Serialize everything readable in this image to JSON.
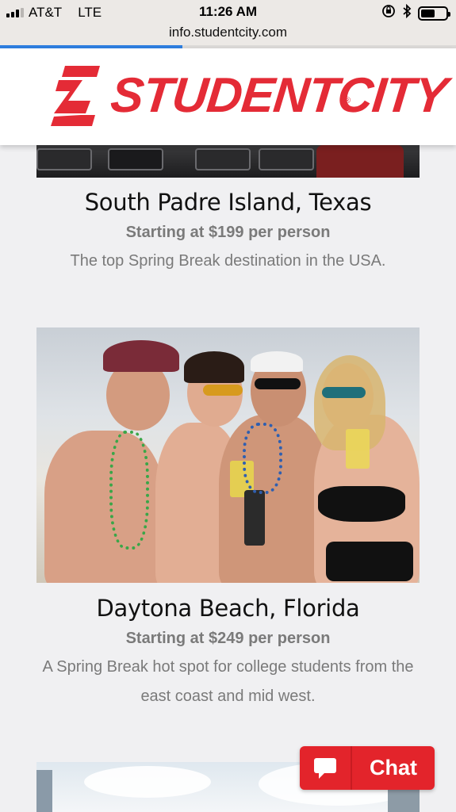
{
  "status_bar": {
    "carrier": "AT&T",
    "network": "LTE",
    "time": "11:26 AM",
    "signal_bars_filled": 3,
    "signal_bars_total": 4,
    "battery_level": 0.55
  },
  "browser": {
    "url": "info.studentcity.com",
    "load_progress": 0.4
  },
  "header": {
    "brand": "STUDENTCITY",
    "registered_mark": "®"
  },
  "destinations": [
    {
      "title": "South Padre Island, Texas",
      "price": "Starting at $199 per person",
      "description": "The top Spring Break destination in the USA."
    },
    {
      "title": "Daytona Beach, Florida",
      "price": "Starting at $249 per person",
      "description": "A Spring Break hot spot for college students from the east coast and mid west."
    }
  ],
  "chat": {
    "label": "Chat"
  },
  "colors": {
    "brand_red": "#e42b36",
    "chat_red": "#e3242b",
    "progress_blue": "#2f7fe0",
    "page_bg": "#f0f0f2"
  }
}
